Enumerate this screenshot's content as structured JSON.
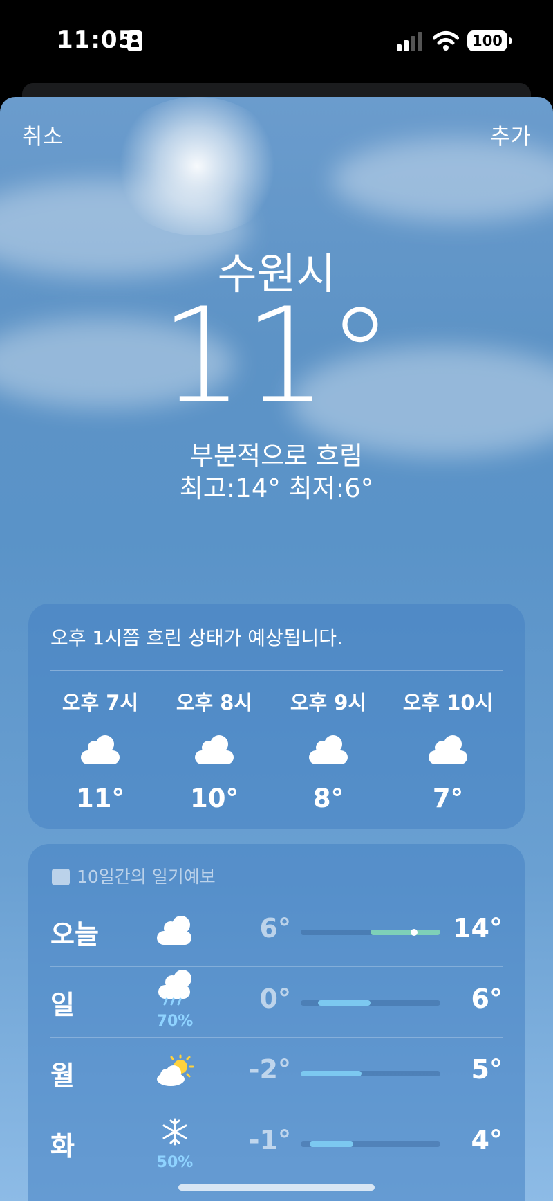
{
  "status_bar": {
    "time": "11:05",
    "battery": "100",
    "icons": [
      "focus-icon",
      "signal-icon",
      "wifi-icon",
      "battery-icon"
    ]
  },
  "nav": {
    "cancel_label": "취소",
    "add_label": "추가"
  },
  "location": {
    "city": "수원시",
    "temperature": "11°",
    "condition": "부분적으로 흐림",
    "high_low": "최고:14°  최저:6°"
  },
  "hourly": {
    "summary": "오후 1시쯤 흐린 상태가 예상됩니다.",
    "items": [
      {
        "time": "오후 7시",
        "icon": "cloud-icon",
        "temp": "11°"
      },
      {
        "time": "오후 8시",
        "icon": "cloud-icon",
        "temp": "10°"
      },
      {
        "time": "오후 9시",
        "icon": "cloud-icon",
        "temp": "8°"
      },
      {
        "time": "오후 10시",
        "icon": "cloud-icon",
        "temp": "7°"
      }
    ]
  },
  "forecast": {
    "title": "10일간의 일기예보",
    "range_min": -2,
    "range_max": 14,
    "days": [
      {
        "day": "오늘",
        "icon": "cloud-icon",
        "precip": "",
        "low": "6°",
        "high": "14°",
        "low_value": 6,
        "high_value": 14,
        "current_value": 11,
        "bar_color": "#7ed0b8"
      },
      {
        "day": "일",
        "icon": "cloud-rain-icon",
        "precip": "70%",
        "low": "0°",
        "high": "6°",
        "low_value": 0,
        "high_value": 6,
        "bar_color": "#7cc8f0"
      },
      {
        "day": "월",
        "icon": "sun-cloud-icon",
        "precip": "",
        "low": "-2°",
        "high": "5°",
        "low_value": -2,
        "high_value": 5,
        "bar_color": "#7cc8f0"
      },
      {
        "day": "화",
        "icon": "snowflake-icon",
        "precip": "50%",
        "low": "-1°",
        "high": "4°",
        "low_value": -1,
        "high_value": 4,
        "bar_color": "#7cc8f0"
      }
    ]
  },
  "colors": {
    "sky_top": "#6b9ccd",
    "sky_bottom": "#8dbbe6",
    "precip_text": "#8fd3ff"
  }
}
